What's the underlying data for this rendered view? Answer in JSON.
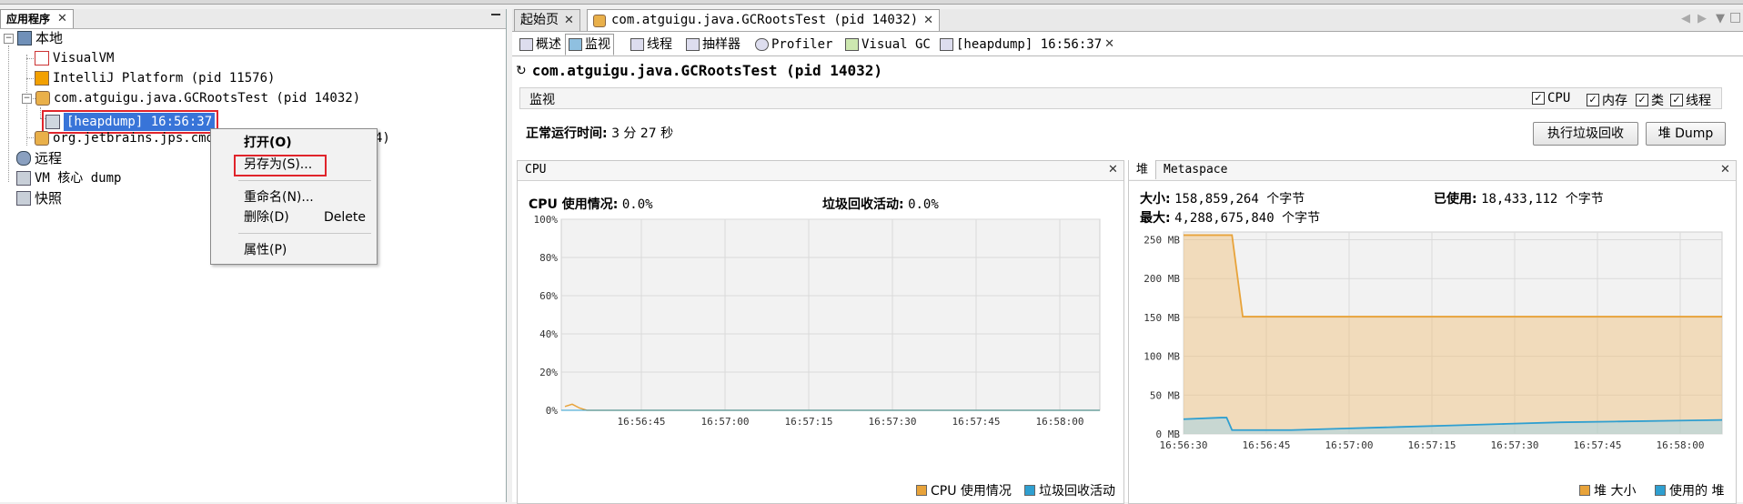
{
  "left": {
    "tab_label": "应用程序",
    "tree": {
      "local": "本地",
      "visualvm": "VisualVM",
      "intellij": "IntelliJ Platform (pid 11576)",
      "gcroots": "com.atguigu.java.GCRootsTest (pid 14032)",
      "heapdump": "[heapdump] 16:56:37",
      "jps_visible": "org.jetbrains.jps.cmdl",
      "jps_tail": "4)",
      "remote": "远程",
      "vm_core": "VM 核心 dump",
      "snapshot": "快照"
    },
    "context_menu": {
      "open": "打开(O)",
      "save_as": "另存为(S)...",
      "rename": "重命名(N)...",
      "delete": "删除(D)",
      "delete_shortcut": "Delete",
      "properties": "属性(P)"
    }
  },
  "right": {
    "doc_tabs": [
      {
        "label": "起始页"
      },
      {
        "label": "com.atguigu.java.GCRootsTest (pid 14032)"
      }
    ],
    "sub_tabs": [
      "概述",
      "监视",
      "线程",
      "抽样器",
      "Profiler",
      "Visual GC",
      "[heapdump] 16:56:37"
    ],
    "process_title": "com.atguigu.java.GCRootsTest (pid 14032)",
    "monitor_label": "监视",
    "checkboxes": [
      "CPU",
      "内存",
      "类",
      "线程"
    ],
    "uptime_label": "正常运行时间:",
    "uptime_value": "3 分 27 秒",
    "buttons": {
      "gc": "执行垃圾回收",
      "heap_dump": "堆 Dump"
    },
    "cpu_panel": {
      "title": "CPU",
      "usage_label": "CPU 使用情况:",
      "usage_value": "0.0%",
      "gc_label": "垃圾回收活动:",
      "gc_value": "0.0%",
      "legend": [
        "CPU 使用情况",
        "垃圾回收活动"
      ]
    },
    "heap_panel": {
      "tab_heap": "堆",
      "tab_meta": "Metaspace",
      "size_label": "大小:",
      "size_value": "158,859,264 个字节",
      "used_label": "已使用:",
      "used_value": "18,433,112 个字节",
      "max_label": "最大:",
      "max_value": "4,288,675,840 个字节",
      "legend": [
        "堆 大小",
        "使用的 堆"
      ]
    },
    "colors": {
      "cpu": "#e8a33a",
      "gc": "#2f9fd0",
      "heap_size": "#e8a33a",
      "heap_used": "#2f9fd0"
    }
  },
  "chart_data": [
    {
      "type": "area",
      "title": "CPU",
      "x": [
        "16:56:45",
        "16:57:00",
        "16:57:15",
        "16:57:30",
        "16:57:45",
        "16:58:00"
      ],
      "yticks": [
        "0%",
        "20%",
        "40%",
        "60%",
        "80%",
        "100%"
      ],
      "ylim": [
        0,
        100
      ],
      "series": [
        {
          "name": "CPU 使用情况",
          "values": [
            0.5,
            0.8,
            0.3,
            0.0,
            0.0,
            0.0,
            0.0,
            0.0,
            0.0,
            0.0
          ]
        },
        {
          "name": "垃圾回收活动",
          "values": [
            0,
            0,
            0,
            0,
            0,
            0,
            0,
            0,
            0,
            0
          ]
        }
      ]
    },
    {
      "type": "area",
      "title": "堆",
      "x": [
        "16:56:30",
        "16:56:45",
        "16:57:00",
        "16:57:15",
        "16:57:30",
        "16:57:45",
        "16:58:00"
      ],
      "yticks": [
        "0 MB",
        "50 MB",
        "100 MB",
        "150 MB",
        "200 MB",
        "250 MB"
      ],
      "ylim": [
        0,
        260
      ],
      "series": [
        {
          "name": "堆 大小",
          "points": [
            [
              0,
              256
            ],
            [
              0.09,
              256
            ],
            [
              0.11,
              151
            ],
            [
              1,
              151
            ]
          ]
        },
        {
          "name": "使用的 堆",
          "points": [
            [
              0,
              19
            ],
            [
              0.07,
              21
            ],
            [
              0.08,
              21
            ],
            [
              0.09,
              5
            ],
            [
              0.2,
              5
            ],
            [
              0.3,
              7
            ],
            [
              0.4,
              9
            ],
            [
              0.5,
              11
            ],
            [
              0.6,
              13
            ],
            [
              0.7,
              15
            ],
            [
              0.8,
              16
            ],
            [
              0.9,
              17
            ],
            [
              1,
              18
            ]
          ]
        }
      ]
    }
  ]
}
